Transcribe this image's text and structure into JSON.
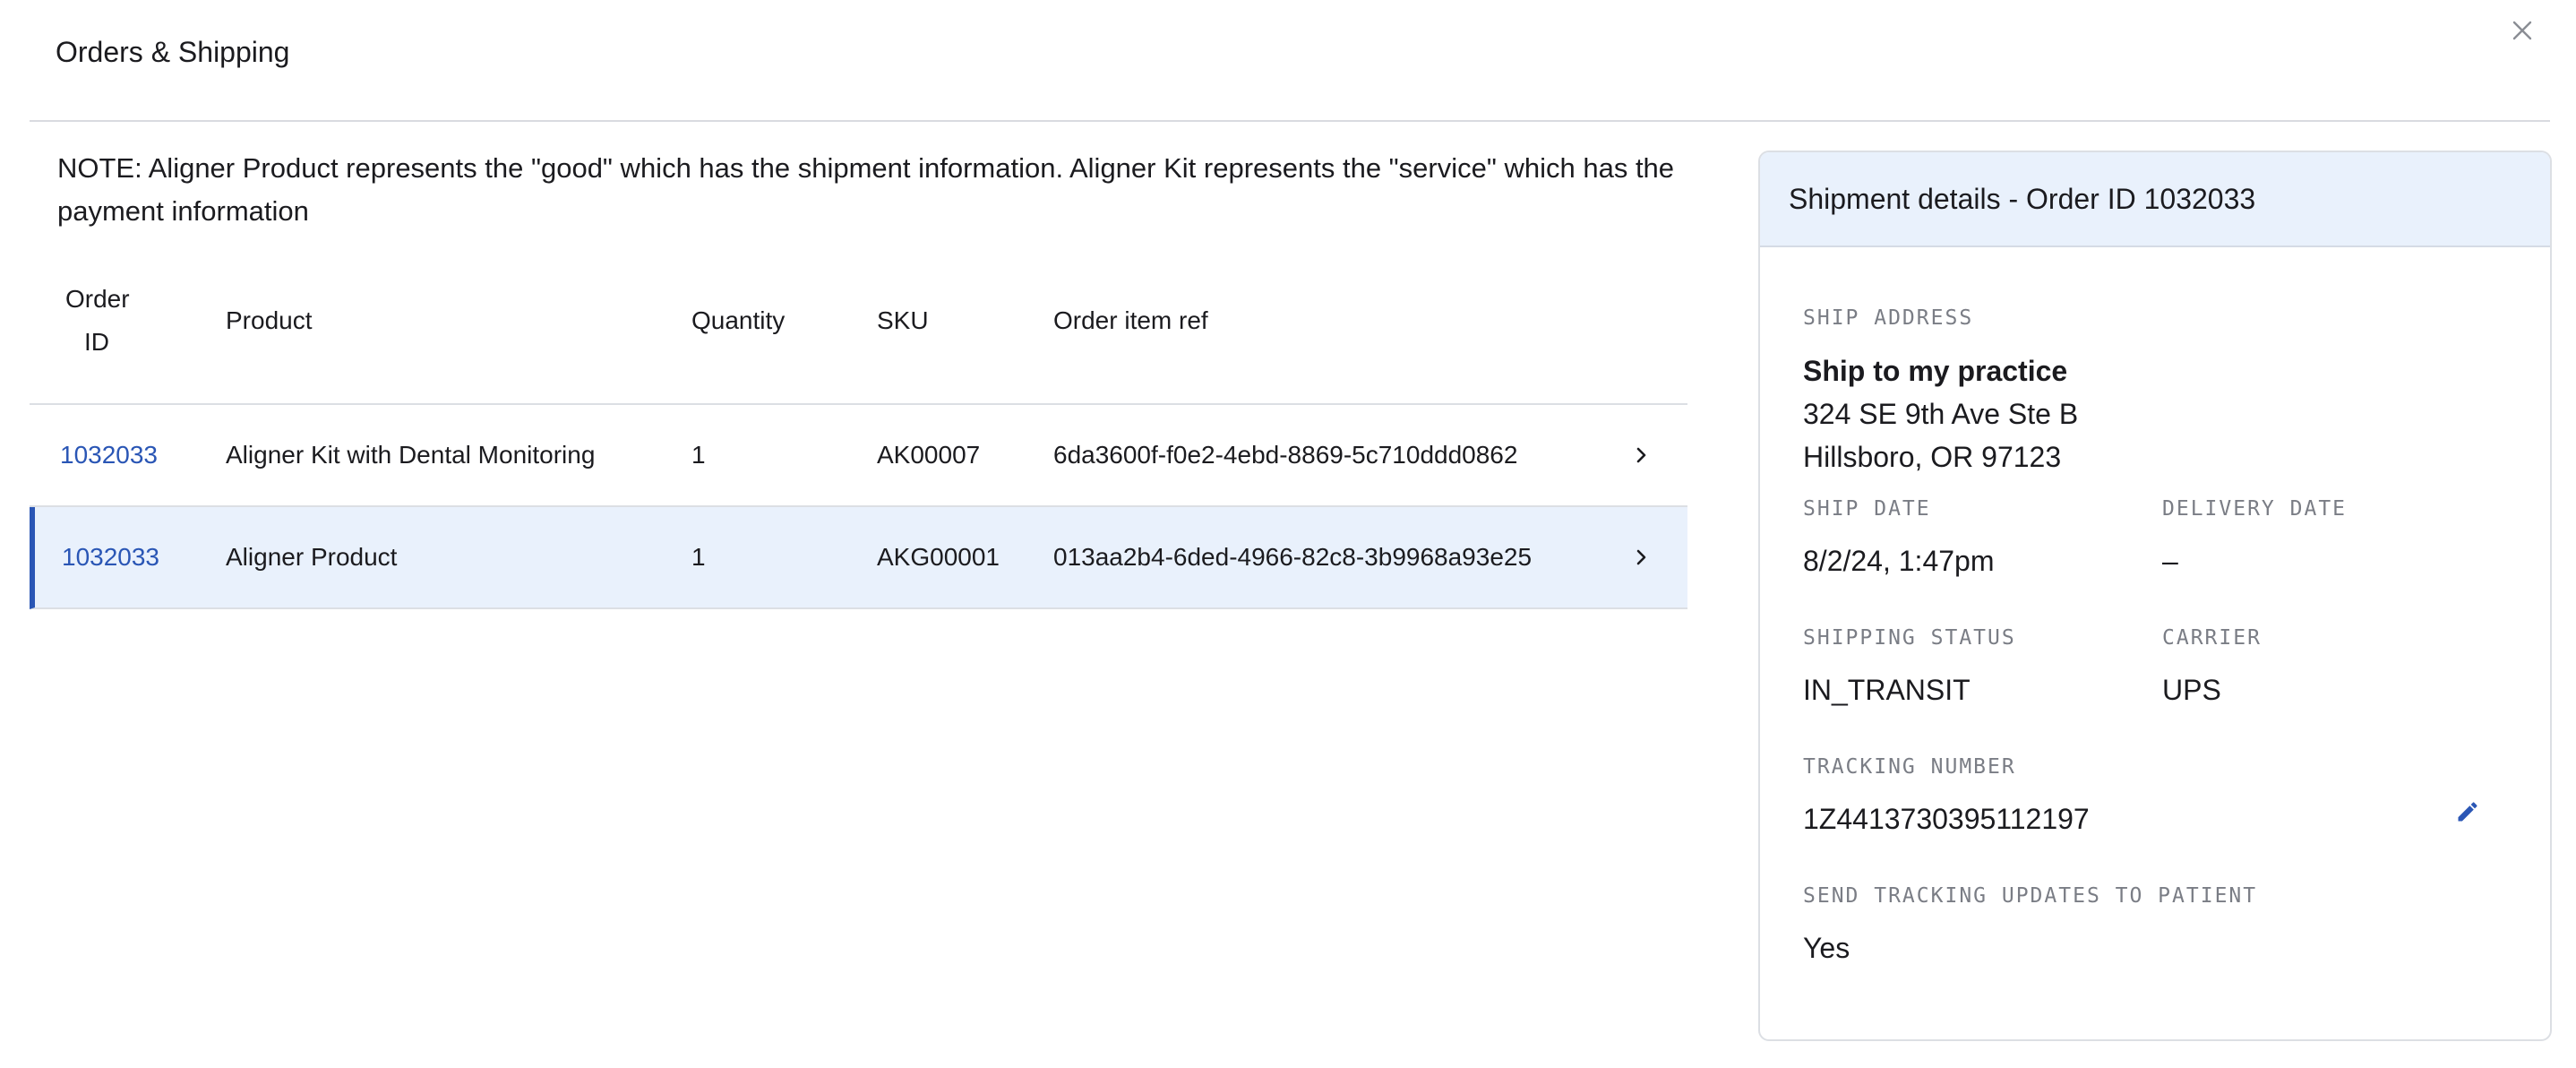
{
  "modal": {
    "title": "Orders & Shipping"
  },
  "note": "NOTE: Aligner Product represents the \"good\" which has the shipment information. Aligner Kit represents the \"service\" which has the payment information",
  "table": {
    "headers": {
      "order_id_line1": "Order",
      "order_id_line2": "ID",
      "product": "Product",
      "quantity": "Quantity",
      "sku": "SKU",
      "order_item_ref": "Order item ref"
    },
    "rows": [
      {
        "order_id": "1032033",
        "product": "Aligner Kit with Dental Monitoring",
        "quantity": "1",
        "sku": "AK00007",
        "order_item_ref": "6da3600f-f0e2-4ebd-8869-5c710ddd0862",
        "selected": false
      },
      {
        "order_id": "1032033",
        "product": "Aligner Product",
        "quantity": "1",
        "sku": "AKG00001",
        "order_item_ref": "013aa2b4-6ded-4966-82c8-3b9968a93e25",
        "selected": true
      }
    ]
  },
  "details": {
    "title": "Shipment details - Order ID 1032033",
    "ship_address_label": "SHIP ADDRESS",
    "ship_address_name": "Ship to my practice",
    "ship_address_line1": "324 SE 9th Ave Ste B",
    "ship_address_line2": "Hillsboro, OR 97123",
    "ship_date_label": "SHIP DATE",
    "ship_date": "8/2/24, 1:47pm",
    "delivery_date_label": "DELIVERY DATE",
    "delivery_date": "–",
    "shipping_status_label": "SHIPPING STATUS",
    "shipping_status": "IN_TRANSIT",
    "carrier_label": "CARRIER",
    "carrier": "UPS",
    "tracking_number_label": "TRACKING NUMBER",
    "tracking_number": "1Z4413730395112197",
    "send_updates_label": "SEND TRACKING UPDATES TO PATIENT",
    "send_updates": "Yes"
  },
  "icons": {
    "close": "close-icon",
    "chevron": "chevron-right-icon",
    "edit": "pencil-icon"
  },
  "colors": {
    "accent": "#2a56b5",
    "selected_row_bg": "#e9f1fc",
    "label_gray": "#7a7d85",
    "divider": "#dcdfe4"
  }
}
